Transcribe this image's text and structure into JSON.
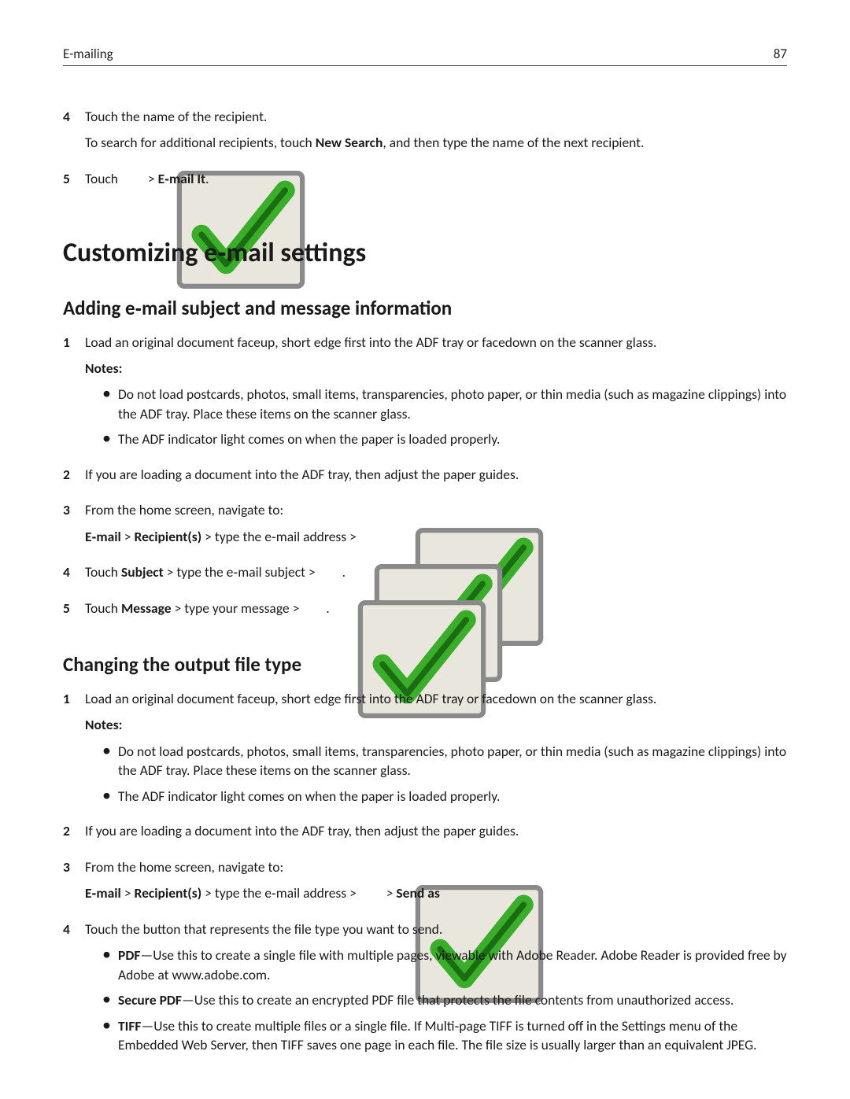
{
  "header": {
    "left": "E-mailing",
    "page": "87"
  },
  "steps_top": {
    "s4": {
      "num": "4",
      "line1": "Touch the name of the recipient.",
      "line2_a": "To search for additional recipients, touch ",
      "line2_b": "New Search",
      "line2_c": ", and then type the name of the next recipient."
    },
    "s5": {
      "num": "5",
      "a": "Touch ",
      "b": " > ",
      "c": "E‑mail It",
      "d": "."
    }
  },
  "h1": "Customizing e‑mail settings",
  "sec1": {
    "title": "Adding e‑mail subject and message information",
    "s1": {
      "num": "1",
      "text": "Load an original document faceup, short edge first into the ADF tray or facedown on the scanner glass."
    },
    "notes_label": "Notes:",
    "note1": "Do not load postcards, photos, small items, transparencies, photo paper, or thin media (such as magazine clippings) into the ADF tray. Place these items on the scanner glass.",
    "note2": "The ADF indicator light comes on when the paper is loaded properly.",
    "s2": {
      "num": "2",
      "text": "If you are loading a document into the ADF tray, then adjust the paper guides."
    },
    "s3": {
      "num": "3",
      "text": "From the home screen, navigate to:"
    },
    "path": {
      "a": "E‑mail",
      "b": " > ",
      "c": "Recipient(s)",
      "d": " > type the e‑mail address > "
    },
    "s4": {
      "num": "4",
      "a": "Touch ",
      "b": "Subject",
      "c": " > type the e‑mail subject > ",
      "d": "."
    },
    "s5": {
      "num": "5",
      "a": "Touch ",
      "b": "Message",
      "c": " > type your message > ",
      "d": "."
    }
  },
  "sec2": {
    "title": "Changing the output file type",
    "s1": {
      "num": "1",
      "text": "Load an original document faceup, short edge first into the ADF tray or facedown on the scanner glass."
    },
    "notes_label": "Notes:",
    "note1": "Do not load postcards, photos, small items, transparencies, photo paper, or thin media (such as magazine clippings) into the ADF tray. Place these items on the scanner glass.",
    "note2": "The ADF indicator light comes on when the paper is loaded properly.",
    "s2": {
      "num": "2",
      "text": "If you are loading a document into the ADF tray, then adjust the paper guides."
    },
    "s3": {
      "num": "3",
      "text": "From the home screen, navigate to:"
    },
    "path": {
      "a": "E‑mail",
      "b": " > ",
      "c": "Recipient(s)",
      "d": " > type the e‑mail address > ",
      "e": " > ",
      "f": "Send as"
    },
    "s4": {
      "num": "4",
      "text": "Touch the button that represents the file type you want to send."
    },
    "ft_pdf": {
      "name": "PDF",
      "desc": "—Use this to create a single file with multiple pages, viewable with Adobe Reader. Adobe Reader is provided free by Adobe at www.adobe.com."
    },
    "ft_spdf": {
      "name": "Secure PDF",
      "desc": "—Use this to create an encrypted PDF file that protects the file contents from unauthorized access."
    },
    "ft_tiff": {
      "name": "TIFF",
      "desc": "—Use this to create multiple files or a single file. If Multi‑page TIFF is turned off in the Settings menu of the Embedded Web Server, then TIFF saves one page in each file. The file size is usually larger than an equivalent JPEG."
    }
  }
}
